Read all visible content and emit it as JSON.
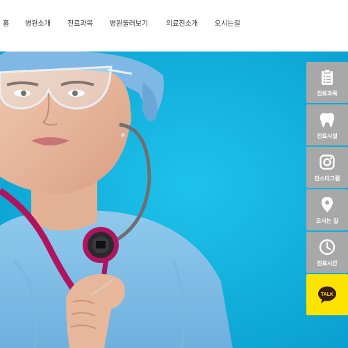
{
  "nav": {
    "items": [
      "홈",
      "병원소개",
      "진료과목",
      "병원둘러보기",
      "의료진소개",
      "오시는길"
    ]
  },
  "hero": {
    "stethoscope_text": "www.hospital.kr"
  },
  "quick_menu": {
    "items": [
      {
        "label": "진료과목",
        "icon": "clipboard-icon"
      },
      {
        "label": "진료시설",
        "icon": "tooth-icon"
      },
      {
        "label": "인스타그램",
        "icon": "instagram-icon"
      },
      {
        "label": "오시는 길",
        "icon": "map-pin-icon"
      },
      {
        "label": "진료시간",
        "icon": "clock-icon"
      }
    ],
    "talk": {
      "label": "TALK",
      "icon": "kakaotalk-icon"
    }
  },
  "colors": {
    "hero_blue": "#0aa6d6",
    "quick_gray": "#a8a8a8",
    "kakao_yellow": "#fde400",
    "kakao_brown": "#3a1d1d"
  }
}
